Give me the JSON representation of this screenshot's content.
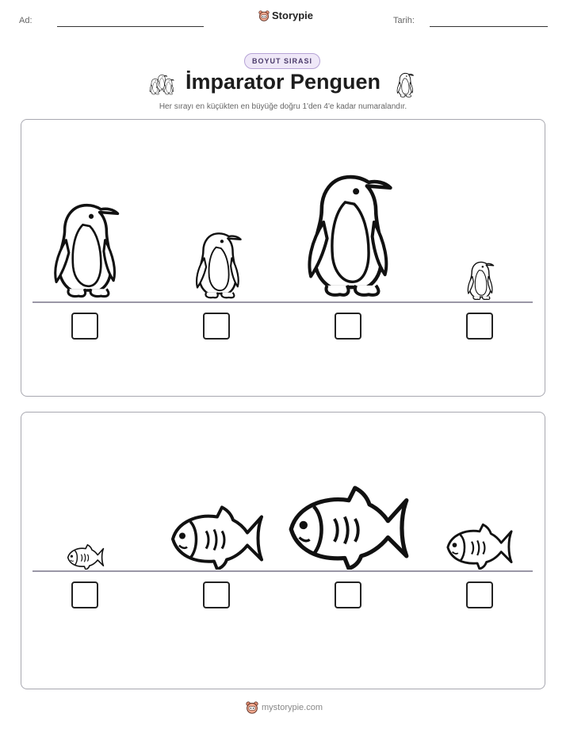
{
  "header": {
    "name_label": "Ad:",
    "date_label": "Tarih:",
    "brand": "Storypie",
    "brand_icon": "bear-icon"
  },
  "badge": "BOYUT SIRASI",
  "title": "İmparator Penguen",
  "subtitle": "Her sırayı en küçükten en büyüğe doğru 1'den 4'e kadar numaralandır.",
  "rows": [
    {
      "subject": "penguin",
      "items": [
        "penguin-medium-large",
        "penguin-medium-small",
        "penguin-largest",
        "penguin-smallest"
      ]
    },
    {
      "subject": "fish",
      "items": [
        "fish-smallest",
        "fish-medium-large",
        "fish-largest",
        "fish-medium-small"
      ]
    }
  ],
  "footer": {
    "text": "mystorypie.com",
    "icon": "bear-icon"
  },
  "colors": {
    "badge_bg": "#efe8f8",
    "badge_border": "#b6a3d6",
    "badge_text": "#4a3a6a",
    "panel_border": "#a8a8b0",
    "ground_line": "#9a97a6"
  }
}
